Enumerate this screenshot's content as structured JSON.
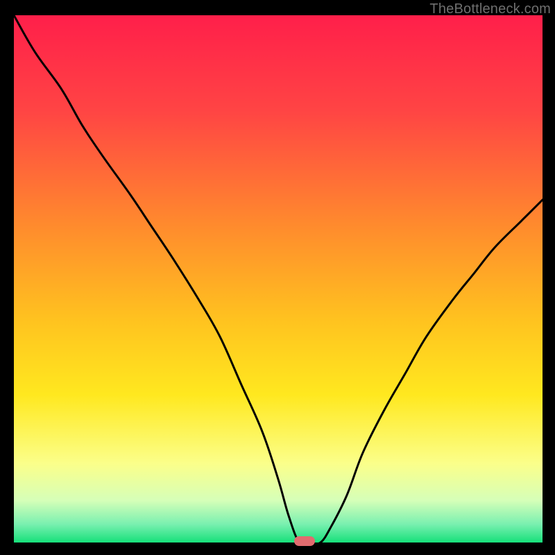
{
  "watermark": "TheBottleneck.com",
  "marker_color": "#e16b6f",
  "gradient_stops": [
    {
      "offset": 0,
      "color": "#ff1f4a"
    },
    {
      "offset": 0.18,
      "color": "#ff4444"
    },
    {
      "offset": 0.4,
      "color": "#ff8b2d"
    },
    {
      "offset": 0.58,
      "color": "#ffc31f"
    },
    {
      "offset": 0.72,
      "color": "#ffe81f"
    },
    {
      "offset": 0.85,
      "color": "#fbff8a"
    },
    {
      "offset": 0.92,
      "color": "#d6ffb8"
    },
    {
      "offset": 0.965,
      "color": "#7af0b0"
    },
    {
      "offset": 1.0,
      "color": "#16e07a"
    }
  ],
  "chart_data": {
    "type": "line",
    "title": "",
    "xlabel": "",
    "ylabel": "",
    "xlim": [
      0,
      100
    ],
    "ylim": [
      0,
      100
    ],
    "grid": false,
    "legend": false,
    "notch_x": 55,
    "series": [
      {
        "name": "curve",
        "x": [
          0,
          4,
          9,
          13,
          17,
          22,
          26,
          30,
          35,
          39,
          43,
          47,
          50,
          52,
          54,
          56,
          58,
          60,
          63,
          66,
          70,
          74,
          78,
          83,
          87,
          91,
          96,
          100
        ],
        "y": [
          100,
          93,
          86,
          79,
          73,
          66,
          60,
          54,
          46,
          39,
          30,
          21,
          12,
          5,
          0,
          0,
          0,
          3,
          9,
          17,
          25,
          32,
          39,
          46,
          51,
          56,
          61,
          65
        ]
      }
    ],
    "marker": {
      "x": 55,
      "y": 0
    }
  }
}
